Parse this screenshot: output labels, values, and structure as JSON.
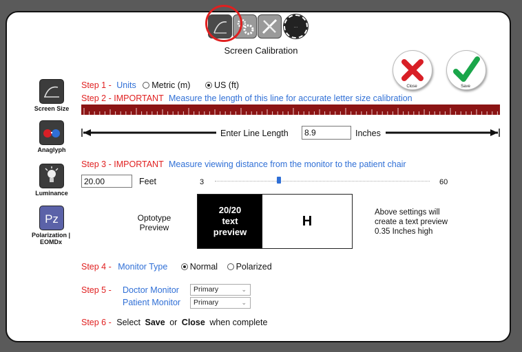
{
  "title": "Screen Calibration",
  "top_icons": [
    {
      "name": "screen-size-tab-icon"
    },
    {
      "name": "settings-gears-tab-icon"
    },
    {
      "name": "tools-tab-icon"
    },
    {
      "name": "reset-tab-icon"
    }
  ],
  "close": {
    "label": "Close",
    "icon": "x-icon",
    "color": "#d81f26"
  },
  "save": {
    "label": "Save",
    "icon": "checkmark-icon",
    "color": "#1aa64a"
  },
  "sidebar": {
    "items": [
      {
        "label": "Screen Size"
      },
      {
        "label": "Anaglyph"
      },
      {
        "label": "Luminance"
      },
      {
        "label": "Polarization | EOMDx"
      }
    ]
  },
  "step1": {
    "prefix": "Step 1 -",
    "label": "Units",
    "options": [
      {
        "label": "Metric (m)",
        "selected": false
      },
      {
        "label": "US (ft)",
        "selected": true
      }
    ]
  },
  "step2": {
    "prefix": "Step 2 - IMPORTANT",
    "text": "Measure the length of this line for accurate letter size calibration",
    "line_label": "Enter Line Length",
    "line_value": "8.9",
    "unit": "Inches"
  },
  "step3": {
    "prefix": "Step 3 - IMPORTANT",
    "text": "Measure viewing distance from the monitor to the patient chair",
    "distance_value": "20.00",
    "distance_unit": "Feet",
    "slider_min": "3",
    "slider_max": "60",
    "slider_value": 20
  },
  "preview": {
    "label_line1": "Optotype",
    "label_line2": "Preview",
    "acuity_line1": "20/20",
    "acuity_line2": "text",
    "acuity_line3": "preview",
    "letter": "H",
    "info_line1": "Above settings will",
    "info_line2": "create a text preview",
    "info_line3": "0.35 Inches high"
  },
  "step4": {
    "prefix": "Step 4 -",
    "label": "Monitor Type",
    "options": [
      {
        "label": "Normal",
        "selected": true
      },
      {
        "label": "Polarized",
        "selected": false
      }
    ]
  },
  "step5": {
    "prefix": "Step 5 -",
    "doctor_label": "Doctor Monitor",
    "doctor_value": "Primary",
    "patient_label": "Patient Monitor",
    "patient_value": "Primary"
  },
  "step6": {
    "prefix": "Step 6 -",
    "text1": "Select",
    "save_word": "Save",
    "text2": "or",
    "close_word": "Close",
    "text3": "when complete"
  },
  "colors": {
    "ruler": "#8b1414",
    "step_red": "#e02020",
    "link_blue": "#2f6fd6",
    "highlight_circle": "#e02020"
  }
}
